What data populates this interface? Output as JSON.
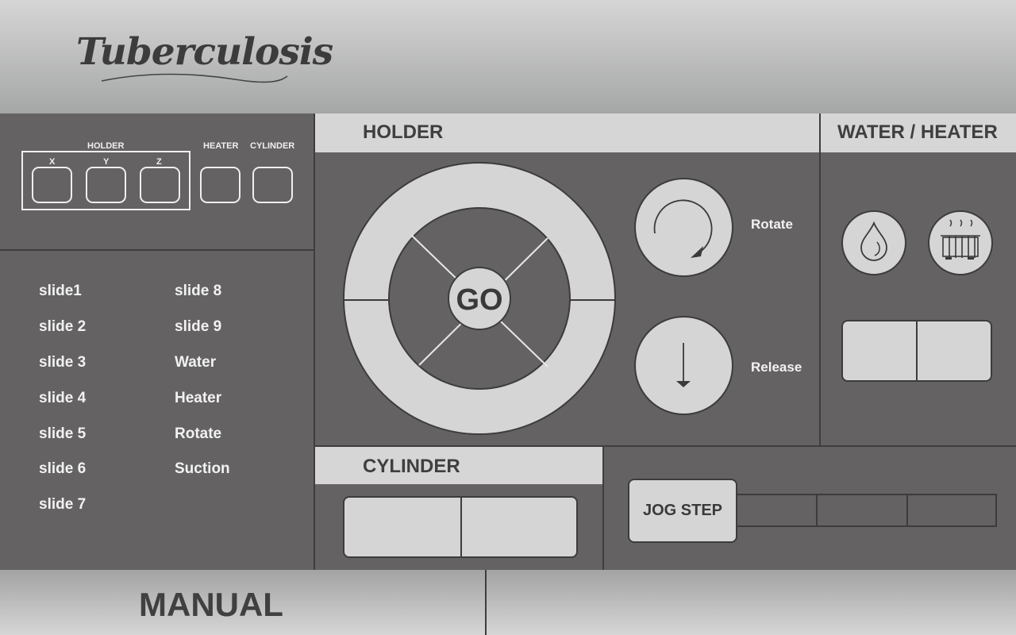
{
  "app": {
    "title": "Tuberculosis"
  },
  "indicators": {
    "holder_label": "HOLDER",
    "axes": [
      "X",
      "Y",
      "Z"
    ],
    "heater_label": "HEATER",
    "cylinder_label": "CYLINDER"
  },
  "slides": {
    "left": [
      "slide1",
      "slide 2",
      "slide 3",
      "slide 4",
      "slide 5",
      "slide 6",
      "slide 7"
    ],
    "right": [
      "slide 8",
      "slide 9",
      "Water",
      "Heater",
      "Rotate",
      "Suction"
    ]
  },
  "holder": {
    "title": "HOLDER",
    "go_label": "GO",
    "rotate_label": "Rotate",
    "release_label": "Release"
  },
  "water_heater": {
    "title": "WATER / HEATER"
  },
  "cylinder": {
    "title": "CYLINDER"
  },
  "jog": {
    "button_label": "JOG STEP"
  },
  "footer": {
    "mode": "MANUAL"
  },
  "colors": {
    "panel": "#646263",
    "control": "#d5d5d5",
    "header_light": "#d6d6d6",
    "text_dark": "#3f3f3f"
  }
}
